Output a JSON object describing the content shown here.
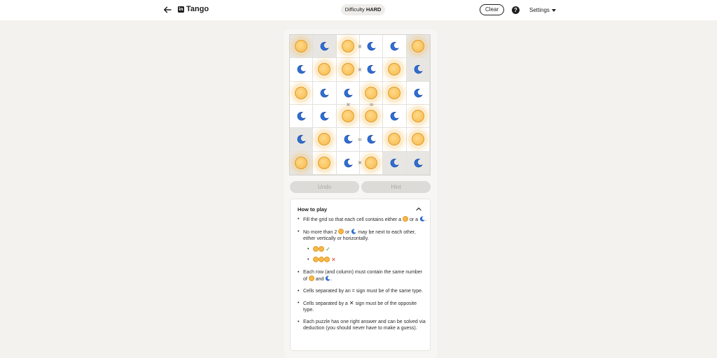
{
  "header": {
    "back_icon": "arrow-left-icon",
    "brand_logo_text": "in",
    "title": "Tango",
    "difficulty_label": "Difficulty",
    "difficulty_value": "HARD",
    "clear_label": "Clear",
    "help_icon": "question-icon",
    "settings_label": "Settings"
  },
  "board": {
    "size": 6,
    "cells": [
      [
        "sun",
        "moon",
        "sun",
        "moon",
        "moon",
        "sun"
      ],
      [
        "moon",
        "sun",
        "sun",
        "moon",
        "sun",
        "moon"
      ],
      [
        "sun",
        "moon",
        "moon",
        "sun",
        "sun",
        "moon"
      ],
      [
        "moon",
        "moon",
        "sun",
        "sun",
        "moon",
        "sun"
      ],
      [
        "moon",
        "sun",
        "moon",
        "moon",
        "sun",
        "sun"
      ],
      [
        "sun",
        "sun",
        "moon",
        "sun",
        "moon",
        "moon"
      ]
    ],
    "locked": [
      [
        true,
        true,
        false,
        false,
        false,
        true
      ],
      [
        false,
        false,
        false,
        false,
        false,
        true
      ],
      [
        false,
        false,
        false,
        false,
        false,
        false
      ],
      [
        false,
        false,
        false,
        false,
        false,
        false
      ],
      [
        true,
        false,
        false,
        false,
        false,
        false
      ],
      [
        true,
        false,
        false,
        false,
        true,
        true
      ]
    ],
    "constraints": [
      {
        "type": "x",
        "row": 0,
        "col": 2,
        "dir": "right",
        "symbol": "×"
      },
      {
        "type": "x",
        "row": 1,
        "col": 2,
        "dir": "right",
        "symbol": "×"
      },
      {
        "type": "x",
        "row": 2,
        "col": 2,
        "dir": "down",
        "symbol": "×"
      },
      {
        "type": "eq",
        "row": 2,
        "col": 3,
        "dir": "down",
        "symbol": "="
      },
      {
        "type": "eq",
        "row": 4,
        "col": 2,
        "dir": "right",
        "symbol": "="
      },
      {
        "type": "x",
        "row": 5,
        "col": 2,
        "dir": "right",
        "symbol": "×"
      }
    ]
  },
  "controls": {
    "undo_label": "Undo",
    "hint_label": "Hint"
  },
  "howto": {
    "title": "How to play",
    "rule1_a": "Fill the grid so that each cell contains either a",
    "rule1_b": "or a",
    "rule1_c": ".",
    "rule2_a": "No more than 2",
    "rule2_b": "or",
    "rule2_c": "may be next to each other, either vertically or horizontally.",
    "check": "✓",
    "cross": "✕",
    "rule3_a": "Each row (and column) must contain the same number of",
    "rule3_b": "and",
    "rule3_c": ".",
    "rule4": "Cells separated by an = sign must be of the same type.",
    "rule5_a": "Cells separated by a",
    "rule5_x": "✕",
    "rule5_b": "sign must be of the opposite type.",
    "rule6": "Each puzzle has one right answer and can be solved via deduction (you should never have to make a guess)."
  }
}
